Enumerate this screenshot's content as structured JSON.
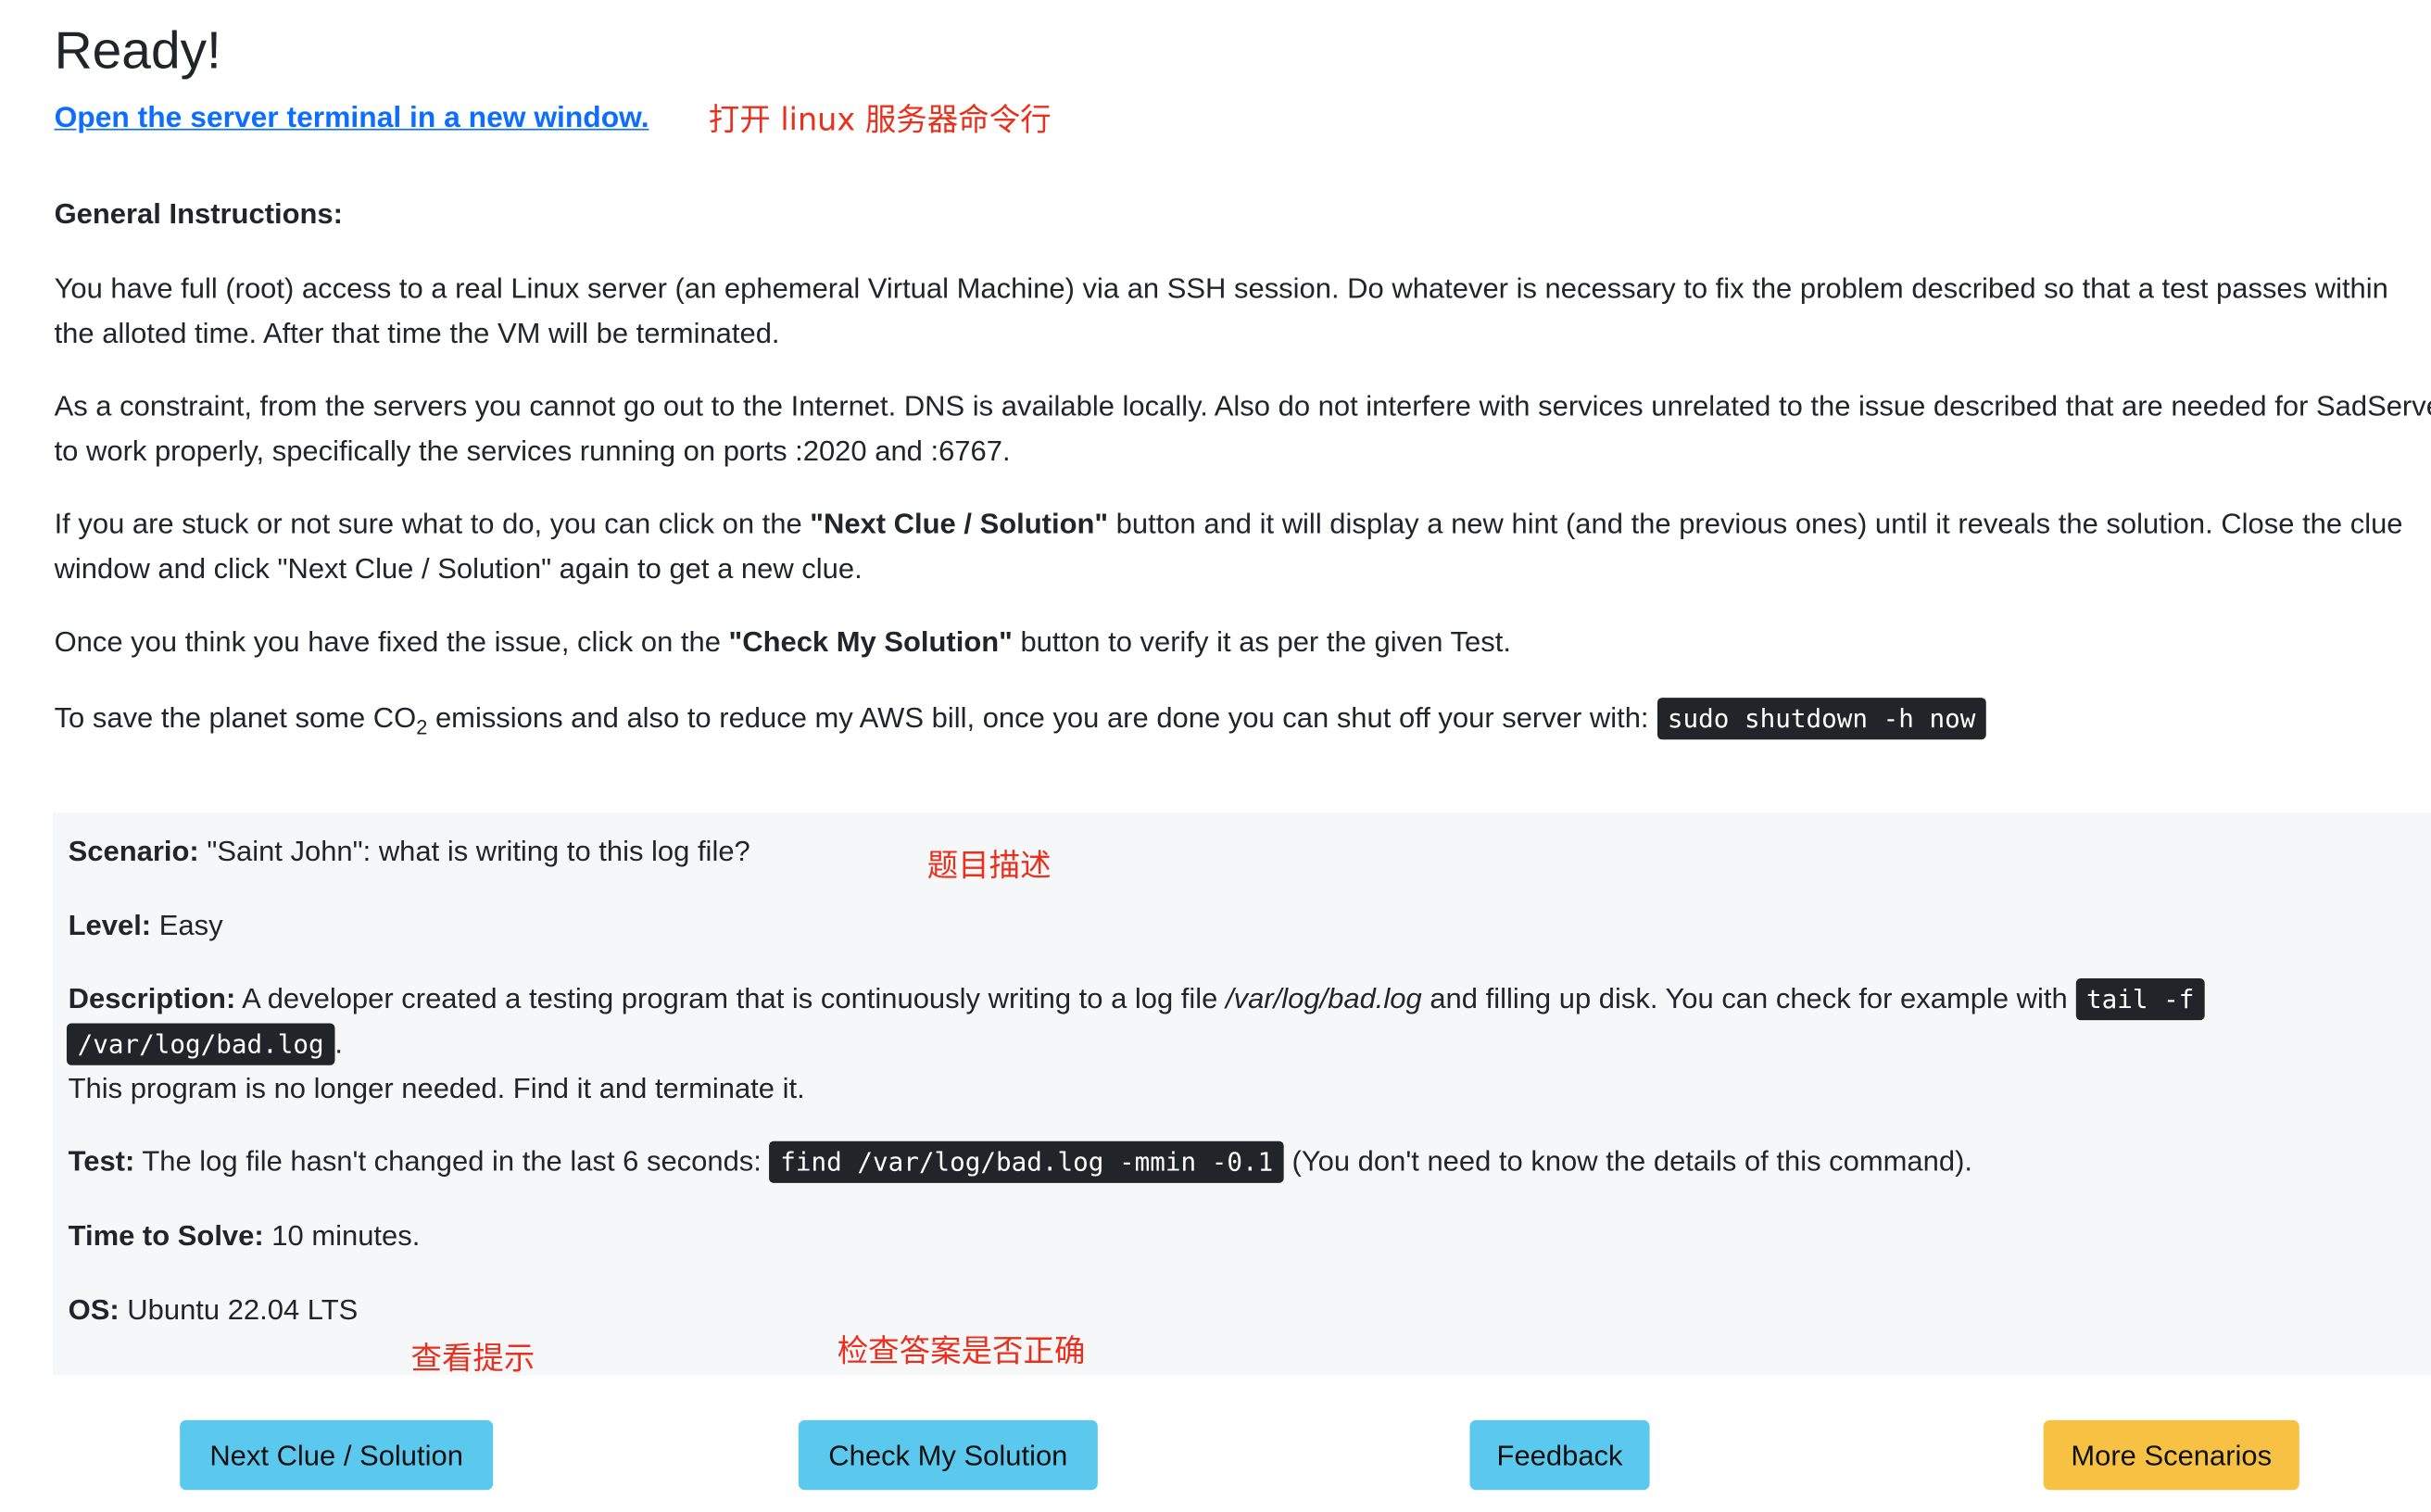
{
  "header": {
    "title": "Ready!",
    "terminal_link": "Open the server terminal in a new window.",
    "note_terminal": "打开 linux 服务器命令行"
  },
  "instructions": {
    "heading": "General Instructions:",
    "p1": "You have full (root) access to a real Linux server (an ephemeral Virtual Machine) via an SSH session. Do whatever is necessary to fix the problem described so that a test passes within the alloted time. After that time the VM will be terminated.",
    "p2": "As a constraint, from the servers you cannot go out to the Internet. DNS is available locally. Also do not interfere with services unrelated to the issue described that are needed for SadServers to work properly, specifically the services running on ports :2020 and :6767.",
    "p3_before": "If you are stuck or not sure what to do, you can click on the ",
    "p3_bold": "\"Next Clue / Solution\"",
    "p3_after": " button and it will display a new hint (and the previous ones) until it reveals the solution. Close the clue window and click \"Next Clue / Solution\" again to get a new clue.",
    "p4_before": "Once you think you have fixed the issue, click on the ",
    "p4_bold": "\"Check My Solution\"",
    "p4_after": " button to verify it as per the given Test.",
    "p5_before": "To save the planet some CO",
    "p5_sub": "2",
    "p5_after": " emissions and also to reduce my AWS bill, once you are done you can shut off your server with: ",
    "p5_code": "sudo shutdown -h now"
  },
  "scenario": {
    "scenario_label": "Scenario:",
    "scenario_value": " \"Saint John\": what is writing to this log file?",
    "note_scenario": "题目描述",
    "level_label": "Level:",
    "level_value": " Easy",
    "desc_label": "Description:",
    "desc_text1": " A developer created a testing program that is continuously writing to a log file ",
    "desc_italic": "/var/log/bad.log",
    "desc_text2": " and filling up disk. You can check for example with ",
    "desc_code1": "tail -f",
    "desc_code2": "/var/log/bad.log",
    "desc_period": ".",
    "desc_line3": "This program is no longer needed. Find it and terminate it.",
    "test_label": "Test:",
    "test_text": " The log file hasn't changed in the last 6 seconds: ",
    "test_code": "find /var/log/bad.log -mmin -0.1",
    "test_after": " (You don't need to know the details of this command).",
    "time_label": "Time to Solve:",
    "time_value": " 10 minutes.",
    "os_label": "OS:",
    "os_value": " Ubuntu 22.04 LTS",
    "note_clue": "查看提示",
    "note_check": "检查答案是否正确"
  },
  "buttons": {
    "next_clue": "Next Clue / Solution",
    "check": "Check My Solution",
    "feedback": "Feedback",
    "more": "More Scenarios"
  },
  "colors": {
    "link": "#0d6efd",
    "note_red": "#e8301c",
    "code_bg": "#212529",
    "btn_info": "#5bc8ee",
    "btn_warning": "#f7c244",
    "scenario_bg": "#f6f7f9"
  }
}
